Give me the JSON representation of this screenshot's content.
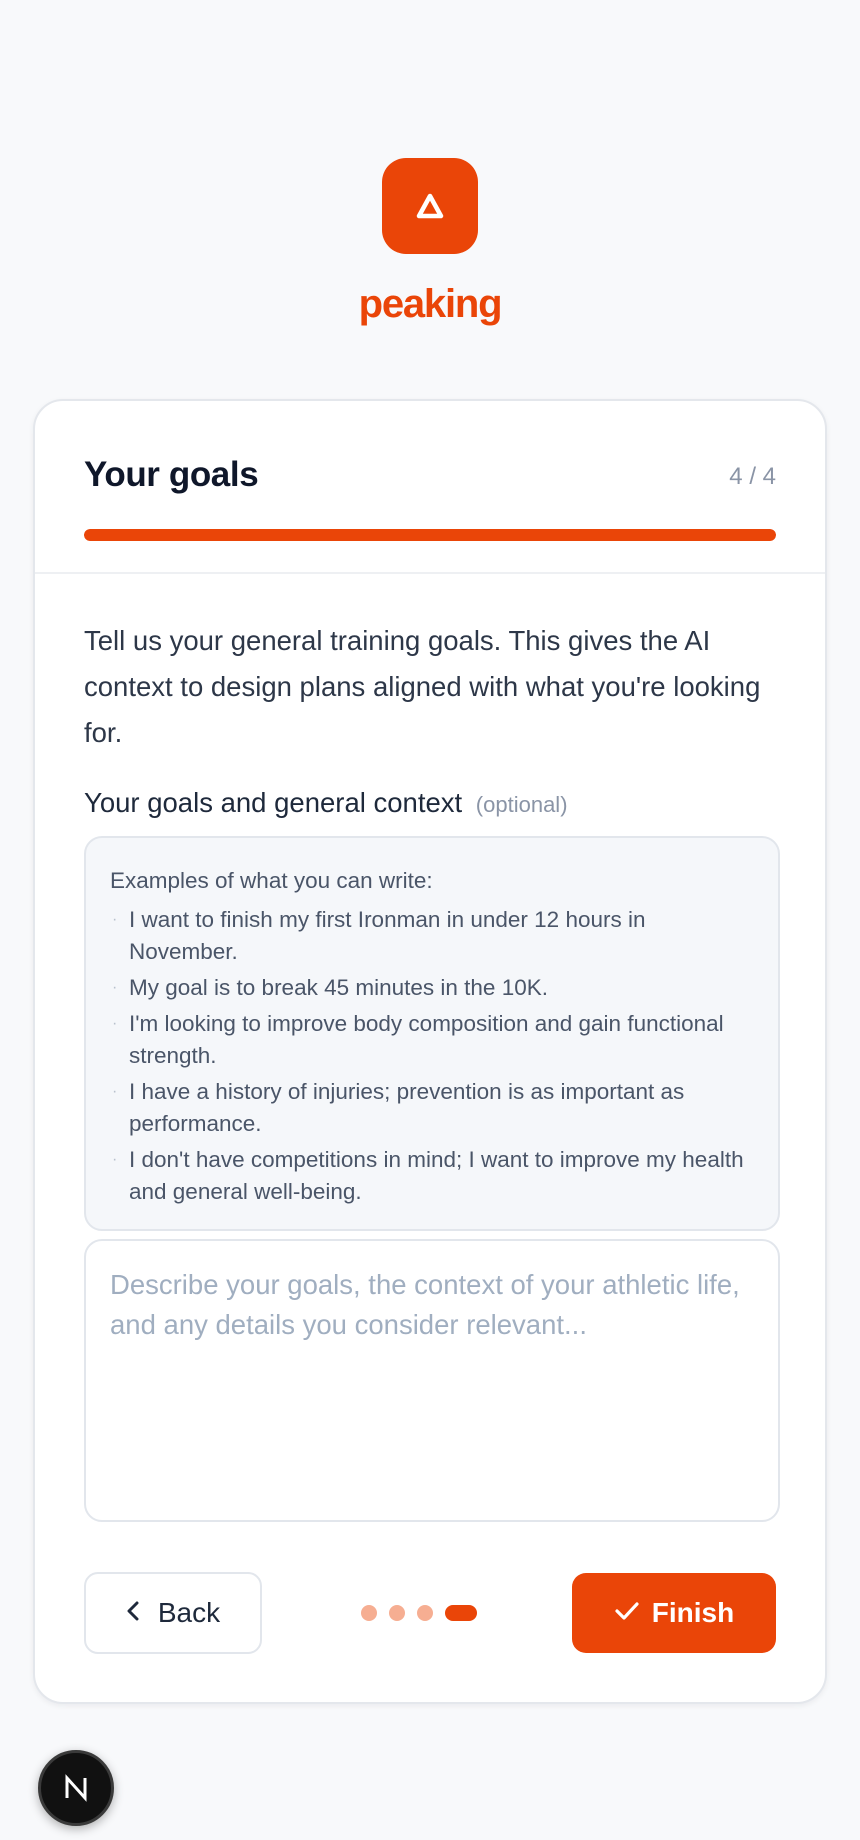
{
  "brand": {
    "name": "peaking",
    "icon": "peak-triangle-icon",
    "color": "#ea4508"
  },
  "header": {
    "title": "Your goals",
    "step": "4 / 4",
    "progress": 1.0
  },
  "intro": "Tell us your general training goals. This gives the AI context to design plans aligned with what you're looking for.",
  "field": {
    "label": "Your goals and general context",
    "optional": "(optional)"
  },
  "examples": {
    "title": "Examples of what you can write:",
    "items": [
      "I want to finish my first Ironman in under 12 hours in November.",
      "My goal is to break 45 minutes in the 10K.",
      "I'm looking to improve body composition and gain functional strength.",
      "I have a history of injuries; prevention is as important as performance.",
      "I don't have competitions in mind; I want to improve my health and general well-being."
    ]
  },
  "textarea": {
    "value": "",
    "placeholder": "Describe your goals, the context of your athletic life, and any details you consider relevant..."
  },
  "footer": {
    "back_label": "Back",
    "finish_label": "Finish",
    "steps_total": 4,
    "current_step": 4
  },
  "dev_badge": {
    "icon": "nextjs-icon"
  }
}
